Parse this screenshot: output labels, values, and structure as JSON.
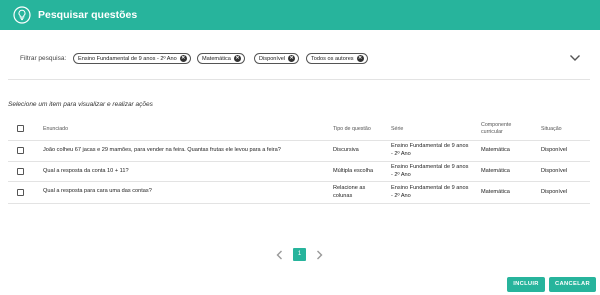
{
  "header": {
    "title": "Pesquisar questões",
    "icon": "lightbulb-icon",
    "color": "#27b49c"
  },
  "filter": {
    "label": "Filtrar pesquisa:",
    "chips": [
      "Ensino Fundamental de 9 anos - 2º Ano",
      "Matemática",
      "Disponível",
      "Todos os autores"
    ]
  },
  "instruction": "Selecione um item para visualizar e realizar ações",
  "table": {
    "headers": {
      "enunciado": "Enunciado",
      "tipo": "Tipo de questão",
      "serie": "Série",
      "componente": "Componente curricular",
      "situacao": "Situação"
    },
    "rows": [
      {
        "enunciado": "João colheu 67 jacas e 29 mamões, para vender na feira. Quantas frutas ele levou para a feira?",
        "tipo": "Discursiva",
        "serie": "Ensino Fundamental de 9 anos - 2º Ano",
        "componente": "Matemática",
        "situacao": "Disponível"
      },
      {
        "enunciado": "Qual a resposta da conta 10 + 11?",
        "tipo": "Múltipla escolha",
        "serie": "Ensino Fundamental de 9 anos - 2º Ano",
        "componente": "Matemática",
        "situacao": "Disponível"
      },
      {
        "enunciado": "Qual a resposta para cara uma das contas?",
        "tipo": "Relacione as colunas",
        "serie": "Ensino Fundamental de 9 anos - 2º Ano",
        "componente": "Matemática",
        "situacao": "Disponível"
      }
    ]
  },
  "pagination": {
    "current": "1"
  },
  "actions": {
    "incluir": "INCLUIR",
    "cancelar": "CANCELAR"
  }
}
